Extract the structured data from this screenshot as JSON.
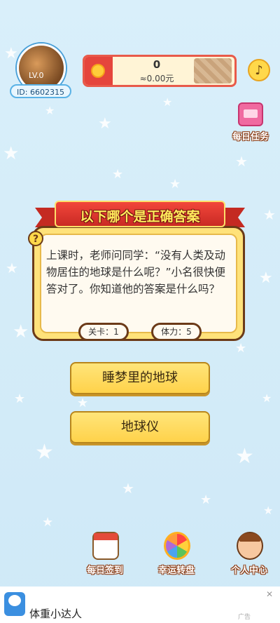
{
  "profile": {
    "level_label": "LV.0",
    "id_label": "ID: 6602315"
  },
  "wallet": {
    "coins": "0",
    "rmb": "≈0.00元"
  },
  "top_right": {
    "music_icon": "♪",
    "daily_task_label": "每日任务"
  },
  "quiz": {
    "title": "以下哪个是正确答案",
    "question_mark": "?",
    "question": "上课时，老师问同学：“没有人类及动物居住的地球是什么呢？”小名很快便答对了。你知道他的答案是什么吗？",
    "level_label": "关卡：1",
    "stamina_label": "体力：5",
    "answers": [
      "睡梦里的地球",
      "地球仪"
    ]
  },
  "bottom_nav": {
    "signin": "每日签到",
    "wheel": "幸运转盘",
    "profile": "个人中心"
  },
  "ad": {
    "title": "体重小达人",
    "close_icon": "✕",
    "mark": "广告"
  },
  "colors": {
    "background": "#d9effa",
    "accent_red": "#e5453c",
    "button_yellow": "#ffd24a",
    "card_border": "#6b3a18"
  }
}
